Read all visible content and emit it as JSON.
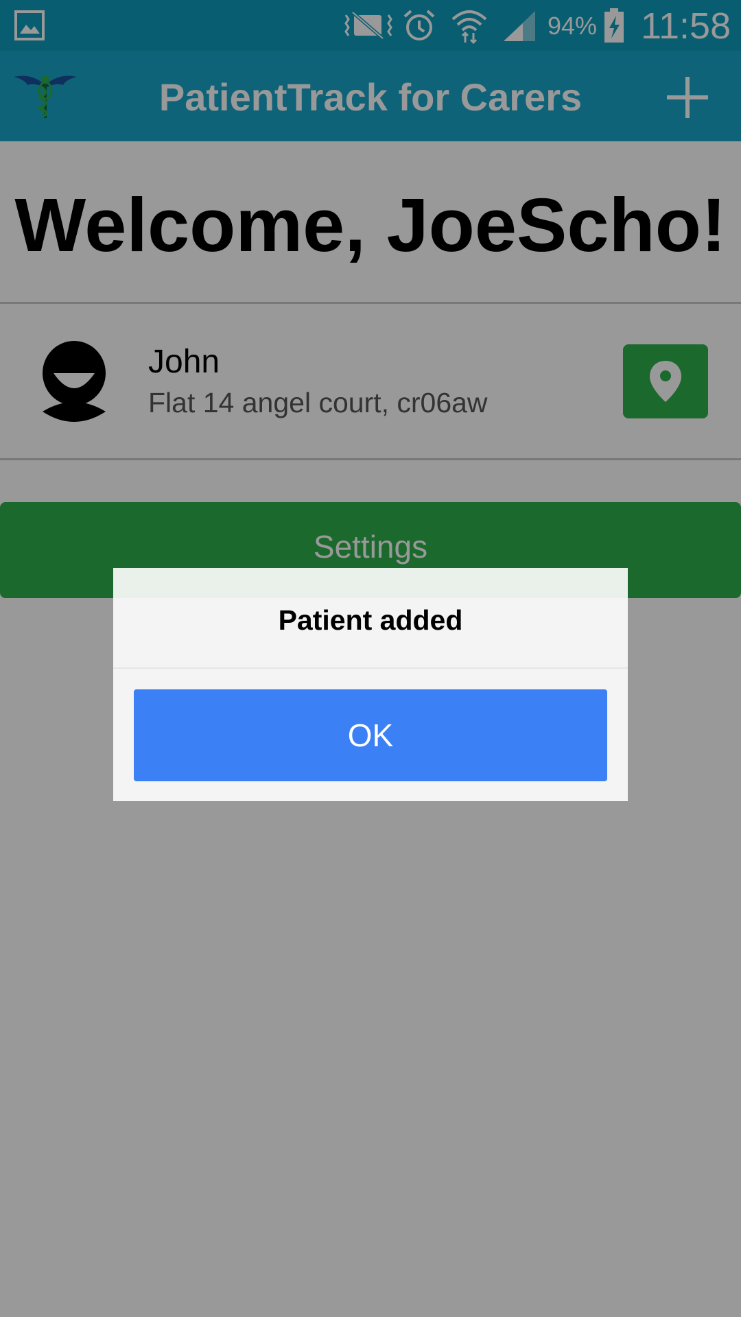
{
  "status_bar": {
    "battery_percent": "94%",
    "time": "11:58",
    "icons": [
      "gallery-icon",
      "vibrate-mute-icon",
      "alarm-icon",
      "wifi-icon",
      "cell-signal-icon",
      "battery-charging-icon"
    ]
  },
  "app_bar": {
    "title": "PatientTrack for Carers",
    "logo_icon": "caduceus-logo-icon",
    "add_icon": "plus-icon"
  },
  "main": {
    "welcome": "Welcome, JoeScho!",
    "patients": [
      {
        "name": "John",
        "address": "Flat 14 angel court, cr06aw",
        "avatar_icon": "person-avatar-icon",
        "map_icon": "map-pin-icon"
      }
    ],
    "settings_label": "Settings"
  },
  "dialog": {
    "title": "Patient added",
    "ok_label": "OK"
  },
  "colors": {
    "status_bar": "#0f9bbd",
    "app_bar": "#1aa5c8",
    "accent_green": "#2db04b",
    "dialog_button": "#3b80f4",
    "scrim": "rgba(0,0,0,0.4)"
  }
}
